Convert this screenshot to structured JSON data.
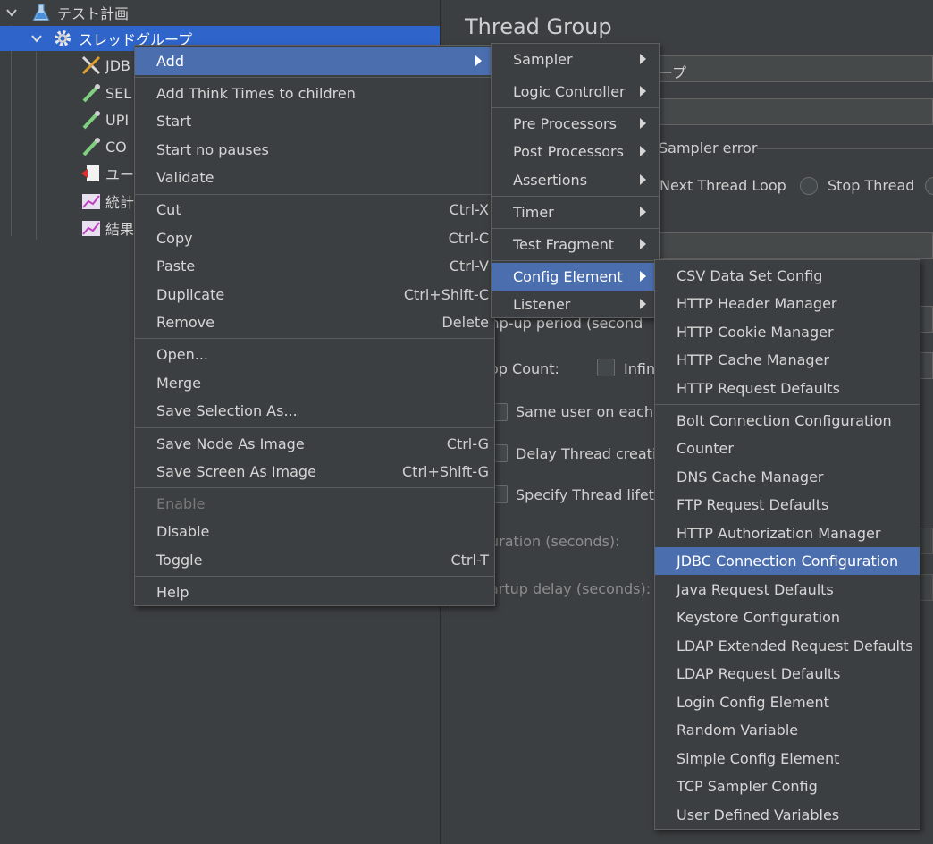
{
  "tree": {
    "test_plan": "テスト計画",
    "thread_group": "スレッドグループ",
    "children": [
      "JDB",
      "SEL",
      "UPI",
      "CO",
      "ユー",
      "統計",
      "結果"
    ]
  },
  "panel": {
    "title": "Thread Group",
    "name_value_fragment": "ープ",
    "sampler_error_label": "Sampler error",
    "next_thread_loop": "Next Thread Loop",
    "stop_thread": "Stop Thread",
    "rampup_label_fragment": "mp-up period (second",
    "loop_count_label_fragment": "op Count:",
    "infinite_fragment": "Infin",
    "same_user_fragment": "Same user on each i",
    "delay_thread_fragment": "Delay Thread creatio",
    "specify_lifetime_fragment": "Specify Thread lifeti",
    "duration_fragment": "uration (seconds):",
    "startup_delay_fragment": "artup delay (seconds):"
  },
  "menu_main": {
    "items": [
      {
        "label": "Add",
        "submenu": true,
        "highlight": true
      },
      {
        "label": "Add Think Times to children"
      },
      {
        "label": "Start"
      },
      {
        "label": "Start no pauses"
      },
      {
        "label": "Validate"
      },
      {
        "label": "Cut",
        "shortcut": "Ctrl-X"
      },
      {
        "label": "Copy",
        "shortcut": "Ctrl-C"
      },
      {
        "label": "Paste",
        "shortcut": "Ctrl-V"
      },
      {
        "label": "Duplicate",
        "shortcut": "Ctrl+Shift-C"
      },
      {
        "label": "Remove",
        "shortcut": "Delete"
      },
      {
        "label": "Open..."
      },
      {
        "label": "Merge"
      },
      {
        "label": "Save Selection As..."
      },
      {
        "label": "Save Node As Image",
        "shortcut": "Ctrl-G"
      },
      {
        "label": "Save Screen As Image",
        "shortcut": "Ctrl+Shift-G"
      },
      {
        "label": "Enable",
        "disabled": true
      },
      {
        "label": "Disable"
      },
      {
        "label": "Toggle",
        "shortcut": "Ctrl-T"
      },
      {
        "label": "Help"
      }
    ]
  },
  "menu_add": {
    "items": [
      {
        "label": "Sampler"
      },
      {
        "label": "Logic Controller"
      },
      {
        "label": "Pre Processors"
      },
      {
        "label": "Post Processors"
      },
      {
        "label": "Assertions"
      },
      {
        "label": "Timer"
      },
      {
        "label": "Test Fragment"
      },
      {
        "label": "Config Element",
        "highlight": true
      },
      {
        "label": "Listener"
      }
    ]
  },
  "menu_config": {
    "items": [
      {
        "label": "CSV Data Set Config"
      },
      {
        "label": "HTTP Header Manager"
      },
      {
        "label": "HTTP Cookie Manager"
      },
      {
        "label": "HTTP Cache Manager"
      },
      {
        "label": "HTTP Request Defaults"
      },
      {
        "label": "Bolt Connection Configuration"
      },
      {
        "label": "Counter"
      },
      {
        "label": "DNS Cache Manager"
      },
      {
        "label": "FTP Request Defaults"
      },
      {
        "label": "HTTP Authorization Manager"
      },
      {
        "label": "JDBC Connection Configuration",
        "highlight": true
      },
      {
        "label": "Java Request Defaults"
      },
      {
        "label": "Keystore Configuration"
      },
      {
        "label": "LDAP Extended Request Defaults"
      },
      {
        "label": "LDAP Request Defaults"
      },
      {
        "label": "Login Config Element"
      },
      {
        "label": "Random Variable"
      },
      {
        "label": "Simple Config Element"
      },
      {
        "label": "TCP Sampler Config"
      },
      {
        "label": "User Defined Variables"
      }
    ]
  },
  "colors": {
    "background": "#3c3f41",
    "menu_highlight": "#4b6eaf",
    "tree_selection": "#2f65ca"
  }
}
